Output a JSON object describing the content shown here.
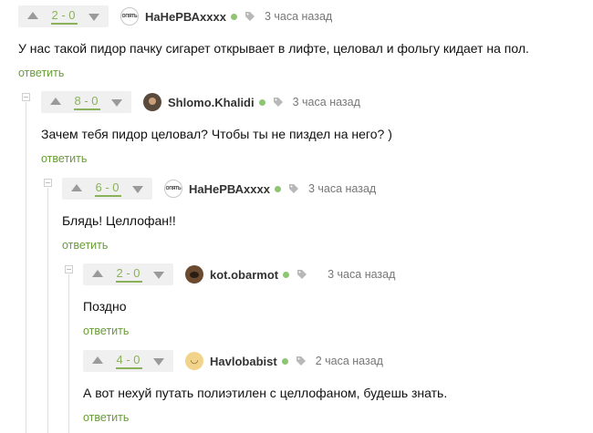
{
  "comments": [
    {
      "id": "c1",
      "score": "2 - 0",
      "username": "НаНеРВАхххх",
      "avatar": "ОПЯТЬ",
      "time": "3 часа назад",
      "text": "У нас такой пидор пачку сигарет открывает в лифте, целовал и фольгу кидает на пол.",
      "reply": "ответить"
    },
    {
      "id": "c2",
      "score": "8 - 0",
      "username": "Shlomo.Khalidi",
      "avatar": "photo",
      "time": "3 часа назад",
      "text": "Зачем тебя пидор целовал? Чтобы ты не пиздел на него? )",
      "reply": "ответить"
    },
    {
      "id": "c3",
      "score": "6 - 0",
      "username": "НаНеРВАхххх",
      "avatar": "ОПЯТЬ",
      "time": "3 часа назад",
      "text": "Блядь! Целлофан!!",
      "reply": "ответить"
    },
    {
      "id": "c4",
      "score": "2 - 0",
      "username": "kot.obarmot",
      "avatar": "photo",
      "time": "3 часа назад",
      "text": "Поздно",
      "reply": "ответить"
    },
    {
      "id": "c5",
      "score": "4 - 0",
      "username": "Havlobabist",
      "avatar": "cute",
      "time": "2 часа назад",
      "text": "А вот нехуй путать полиэтилен с целлофаном, будешь знать.",
      "reply": "ответить"
    }
  ],
  "colors": {
    "score": "#8ab25a",
    "reply": "#6a9c3a",
    "online": "#8dc572",
    "muted": "#777777"
  },
  "icons": {
    "upvote": "triangle-up-icon",
    "downvote": "triangle-down-icon",
    "tag": "tag-icon",
    "collapse": "collapse-minus-icon"
  }
}
